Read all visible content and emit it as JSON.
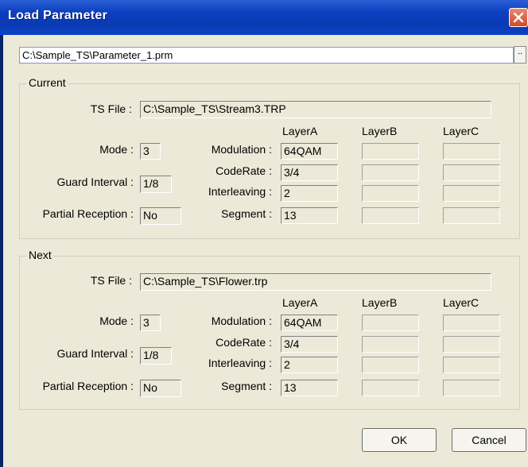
{
  "window": {
    "title": "Load Parameter"
  },
  "file_path": "C:\\Sample_TS\\Parameter_1.prm",
  "browse_label": "..",
  "labels": {
    "ts_file": "TS File :",
    "mode": "Mode :",
    "guard_interval": "Guard Interval :",
    "partial_reception": "Partial Reception :",
    "modulation": "Modulation :",
    "coderate": "CodeRate :",
    "interleaving": "Interleaving :",
    "segment": "Segment :",
    "layer_a": "LayerA",
    "layer_b": "LayerB",
    "layer_c": "LayerC"
  },
  "current": {
    "group_label": "Current",
    "ts_file": "C:\\Sample_TS\\Stream3.TRP",
    "mode": "3",
    "guard_interval": "1/8",
    "partial_reception": "No",
    "layer_a": {
      "modulation": "64QAM",
      "coderate": "3/4",
      "interleaving": "2",
      "segment": "13"
    },
    "layer_b": {
      "modulation": "",
      "coderate": "",
      "interleaving": "",
      "segment": ""
    },
    "layer_c": {
      "modulation": "",
      "coderate": "",
      "interleaving": "",
      "segment": ""
    }
  },
  "next": {
    "group_label": "Next",
    "ts_file": "C:\\Sample_TS\\Flower.trp",
    "mode": "3",
    "guard_interval": "1/8",
    "partial_reception": "No",
    "layer_a": {
      "modulation": "64QAM",
      "coderate": "3/4",
      "interleaving": "2",
      "segment": "13"
    },
    "layer_b": {
      "modulation": "",
      "coderate": "",
      "interleaving": "",
      "segment": ""
    },
    "layer_c": {
      "modulation": "",
      "coderate": "",
      "interleaving": "",
      "segment": ""
    }
  },
  "buttons": {
    "ok": "OK",
    "cancel": "Cancel"
  },
  "colors": {
    "titlebar": "#0b3fbf",
    "dialog_bg": "#ece9d8",
    "close_button": "#d2492a"
  },
  "icons": {
    "close": "close-icon"
  }
}
